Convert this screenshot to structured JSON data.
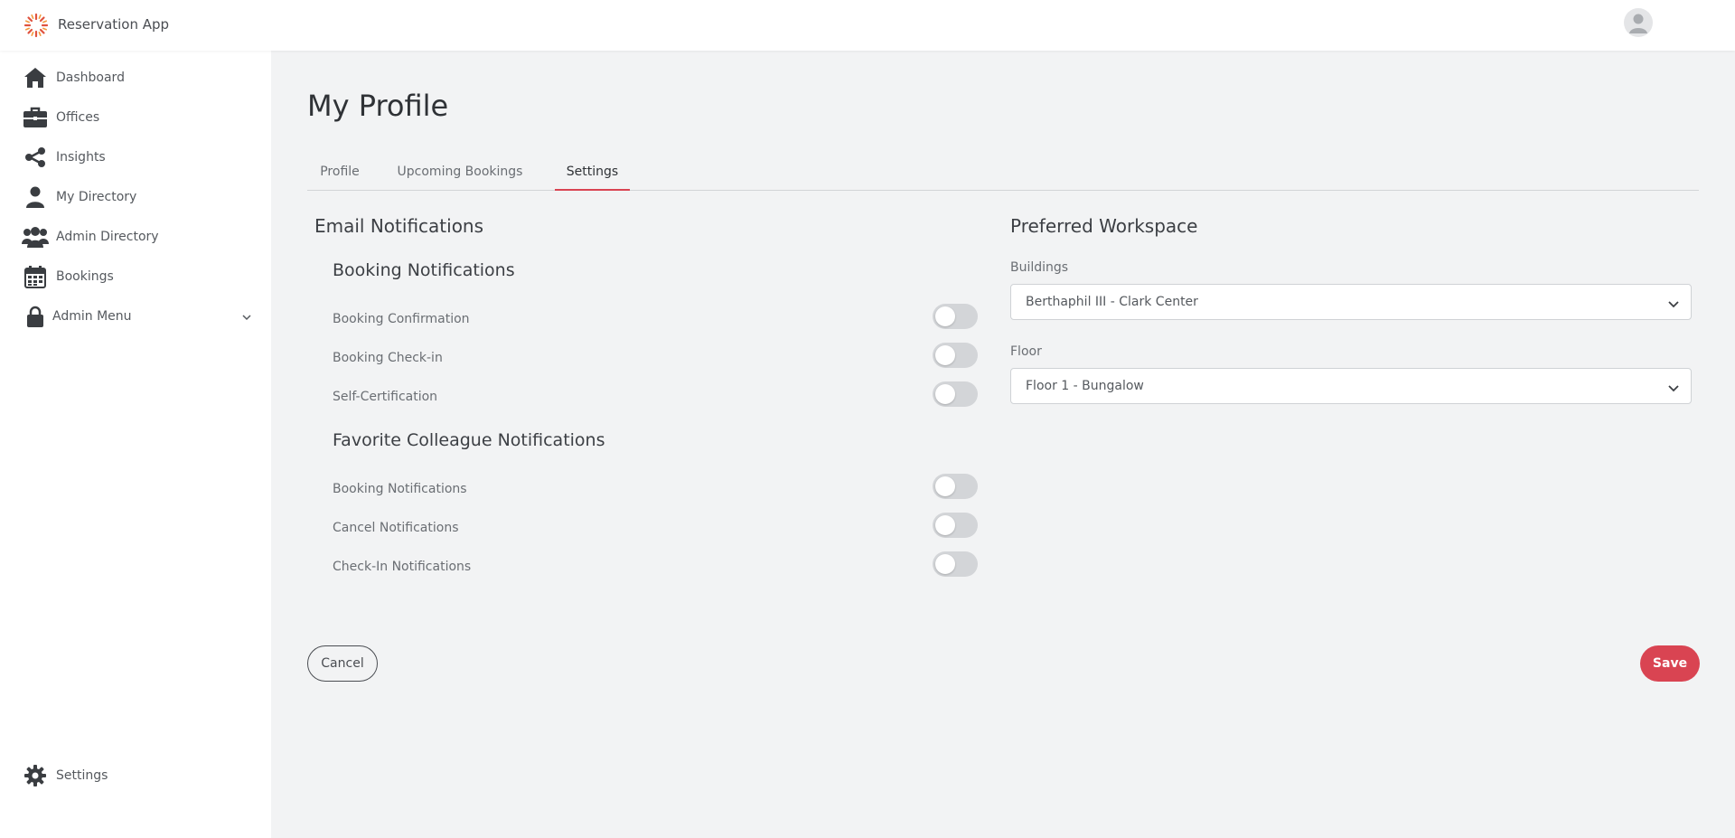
{
  "app": {
    "title": "Reservation App"
  },
  "sidebar": {
    "items": [
      {
        "label": "Dashboard",
        "icon": "home-icon"
      },
      {
        "label": "Offices",
        "icon": "briefcase-icon"
      },
      {
        "label": "Insights",
        "icon": "share-icon"
      },
      {
        "label": "My Directory",
        "icon": "user-icon"
      },
      {
        "label": "Admin Directory",
        "icon": "users-icon"
      },
      {
        "label": "Bookings",
        "icon": "calendar-icon"
      },
      {
        "label": "Admin Menu",
        "icon": "lock-icon"
      }
    ],
    "settings_label": "Settings"
  },
  "page": {
    "title": "My Profile"
  },
  "tabs": [
    {
      "label": "Profile",
      "active": false
    },
    {
      "label": "Upcoming Bookings",
      "active": false
    },
    {
      "label": "Settings",
      "active": true
    }
  ],
  "email_notifications": {
    "heading": "Email Notifications",
    "booking_notifications": {
      "heading": "Booking Notifications",
      "items": [
        {
          "label": "Booking Confirmation",
          "enabled": false
        },
        {
          "label": "Booking Check-in",
          "enabled": false
        },
        {
          "label": "Self-Certification",
          "enabled": false
        }
      ]
    },
    "favorite_colleague_notifications": {
      "heading": "Favorite Colleague Notifications",
      "items": [
        {
          "label": "Booking Notifications",
          "enabled": false
        },
        {
          "label": "Cancel Notifications",
          "enabled": false
        },
        {
          "label": "Check-In Notifications",
          "enabled": false
        }
      ]
    }
  },
  "preferred_workspace": {
    "heading": "Preferred Workspace",
    "buildings": {
      "label": "Buildings",
      "value": "Berthaphil III - Clark Center"
    },
    "floor": {
      "label": "Floor",
      "value": "Floor 1 - Bungalow"
    }
  },
  "actions": {
    "cancel_label": "Cancel",
    "save_label": "Save"
  },
  "colors": {
    "accent": "#d94452",
    "icon": "#3a3d41",
    "toggle_off": "#d3d5d8",
    "background": "#f2f3f4"
  }
}
